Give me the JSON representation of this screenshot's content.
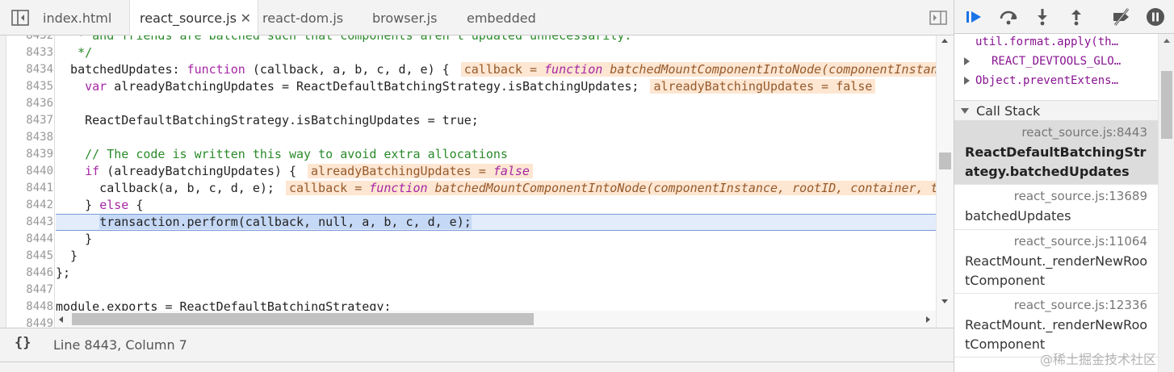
{
  "tabs": [
    {
      "label": "index.html",
      "active": false
    },
    {
      "label": "react_source.js",
      "active": true
    },
    {
      "label": "react-dom.js",
      "active": false
    },
    {
      "label": "browser.js",
      "active": false
    },
    {
      "label": "embedded",
      "active": false
    }
  ],
  "tab_close_glyph": "✕",
  "line_numbers": [
    "8432",
    "8433",
    "8434",
    "8435",
    "8436",
    "8437",
    "8438",
    "8439",
    "8440",
    "8441",
    "8442",
    "8443",
    "8444",
    "8445",
    "8446",
    "8447",
    "8448",
    "8449"
  ],
  "code": {
    "l8432": "   * and friends are batched such that components aren't updated unnecessarily.",
    "l8433": "   */",
    "l8434_a": "  batchedUpdates: ",
    "l8434_kw": "function",
    "l8434_b": " (callback, a, b, c, d, e) {",
    "l8434_inl_a": "callback = ",
    "l8434_inl_kw": "function",
    "l8434_inl_b": " batchedMountComponentIntoNode(componentInstance, rootID, container, transaction, shouldReuseMarkup)",
    "l8435_kw": "var",
    "l8435_b": " alreadyBatchingUpdates = ReactDefaultBatchingStrategy.isBatchingUpdates;",
    "l8435_inl": "alreadyBatchingUpdates = false",
    "l8437": "    ReactDefaultBatchingStrategy.isBatchingUpdates = true;",
    "l8439": "    // The code is written this way to avoid extra allocations",
    "l8440_kw": "if",
    "l8440_b": " (alreadyBatchingUpdates) {",
    "l8440_inl_a": "alreadyBatchingUpdates = ",
    "l8440_inl_kw": "false",
    "l8441_b": "      callback(a, b, c, d, e);",
    "l8441_inl_a": "callback = ",
    "l8441_inl_kw": "function",
    "l8441_inl_b": " batchedMountComponentIntoNode(componentInstance, rootID, container, transaction, shouldReuseMarkup)",
    "l8442_a": "    } ",
    "l8442_kw": "else",
    "l8442_b": " {",
    "l8443_sel": "transaction.perform(callback, null, a, b, c, d, e);",
    "l8444": "    }",
    "l8445": "  }",
    "l8446": "};",
    "l8448": "module.exports = ReactDefaultBatchingStrategy;"
  },
  "status": {
    "pretty_print": "{}",
    "cursor": "Line 8443, Column 7"
  },
  "debugger": {
    "scope_rows": [
      {
        "text": "util.format.apply(th…",
        "expandable": false
      },
      {
        "text": "REACT_DEVTOOLS_GLO…",
        "expandable": true
      },
      {
        "text": "Object.preventExtens…",
        "expandable": true
      }
    ],
    "callstack_title": "Call Stack",
    "frames": [
      {
        "location": "react_source.js:8443",
        "function": "ReactDefaultBatchingStrategy.batchedUpdates",
        "selected": true
      },
      {
        "location": "react_source.js:13689",
        "function": "batchedUpdates",
        "selected": false
      },
      {
        "location": "react_source.js:11064",
        "function": "ReactMount._renderNewRootComponent",
        "selected": false
      },
      {
        "location": "react_source.js:12336",
        "function": "ReactMount._renderNewRootComponent",
        "selected": false
      }
    ]
  },
  "watermark": "@稀土掘金技术社区",
  "colors": {
    "accent": "#1a73e8",
    "inline_value_bg": "#fde6d2",
    "keyword": "#a626a4",
    "comment": "#2a8a2a"
  }
}
